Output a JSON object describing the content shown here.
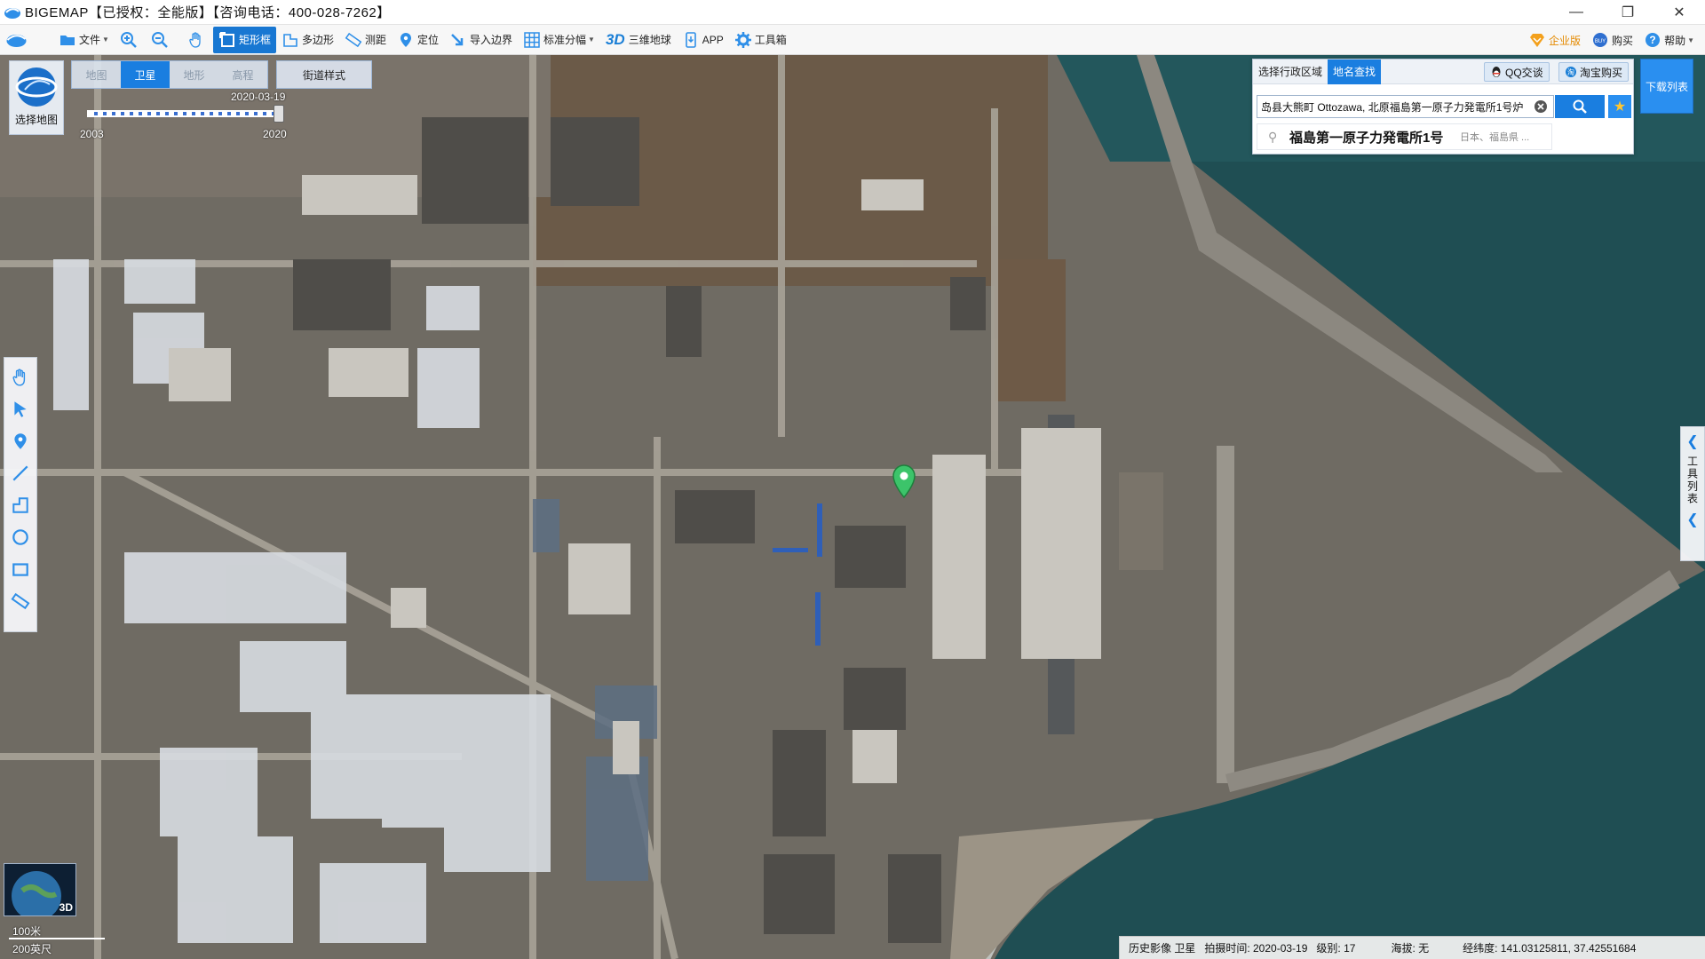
{
  "window": {
    "title": "BIGEMAP【已授权：全能版】【咨询电话：400-028-7262】",
    "buttons": [
      "minimize",
      "restore",
      "close"
    ]
  },
  "toolbar": {
    "items": [
      {
        "label": "文件",
        "icon": "folder-icon",
        "dropdown": true
      },
      {
        "label": "",
        "icon": "zoom-in-icon"
      },
      {
        "label": "",
        "icon": "zoom-out-icon"
      },
      {
        "label": "",
        "icon": "pan-hand-icon"
      },
      {
        "label": "矩形框",
        "icon": "rectangle-select-icon",
        "active": true
      },
      {
        "label": "多边形",
        "icon": "polygon-icon"
      },
      {
        "label": "测距",
        "icon": "ruler-icon"
      },
      {
        "label": "定位",
        "icon": "location-pin-icon"
      },
      {
        "label": "导入边界",
        "icon": "import-boundary-icon"
      },
      {
        "label": "标准分幅",
        "icon": "grid-icon",
        "dropdown": true
      },
      {
        "label": "三维地球",
        "icon": "3d-icon",
        "prefix": "3D"
      },
      {
        "label": "APP",
        "icon": "phone-icon"
      },
      {
        "label": "工具箱",
        "icon": "gear-icon"
      }
    ],
    "right": [
      {
        "label": "企业版",
        "icon": "enterprise-icon"
      },
      {
        "label": "购买",
        "icon": "buy-icon"
      },
      {
        "label": "帮助",
        "icon": "help-icon",
        "dropdown": true
      }
    ]
  },
  "map_types": {
    "tabs": [
      "地图",
      "卫星",
      "地形",
      "高程"
    ],
    "selected": "卫星",
    "street_style": "街道样式"
  },
  "select_map": {
    "label": "选择地图"
  },
  "timeline": {
    "current_date": "2020-03-19",
    "start_year": "2003",
    "end_year": "2020"
  },
  "search_panel": {
    "tabs": [
      "选择行政区域",
      "地名查找"
    ],
    "selected_tab": "地名查找",
    "qq_button": "QQ交谈",
    "taobao_button": "淘宝购买",
    "query": "岛县大熊町 Ottozawa, 北原福島第一原子力発電所1号炉",
    "result_name": "福島第一原子力発電所1号",
    "result_region": "日本、福島県 ..."
  },
  "download_list": "下载列表",
  "tool_list": "工具列表",
  "thumb3d_label": "3D",
  "scale": {
    "metric": "100米",
    "imperial": "200英尺"
  },
  "status": {
    "imagery": "历史影像 卫星",
    "capture_time": "拍摄时间: 2020-03-19",
    "level": "级别:  17",
    "altitude": "海拔: 无",
    "coords": "经纬度:   141.03125811, 37.42551684"
  },
  "colors": {
    "accent": "#1a7ee0",
    "sea": "#1d4f55",
    "ground": "#8a847a",
    "marker": "#3cc46a"
  }
}
